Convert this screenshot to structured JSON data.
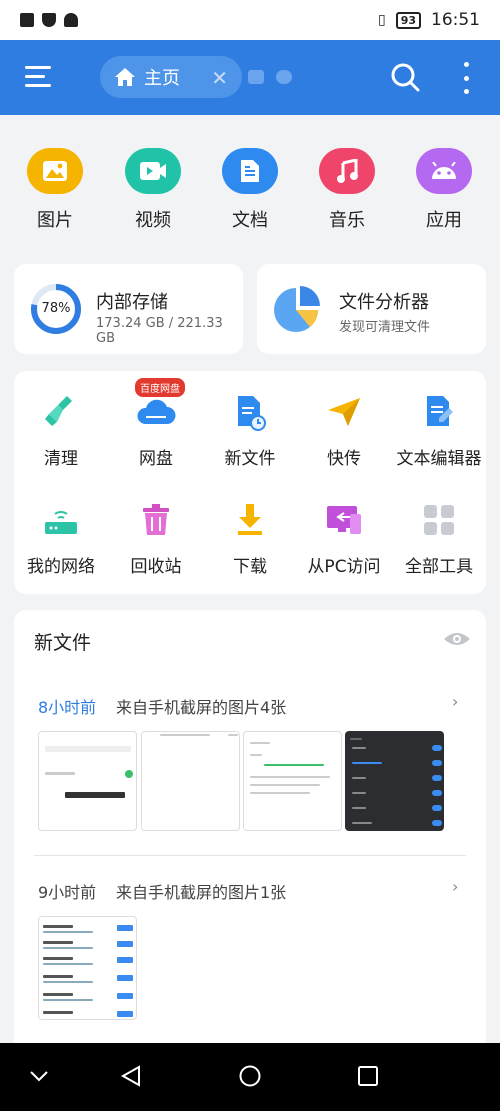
{
  "status_bar": {
    "time": "16:51",
    "battery": "93"
  },
  "header": {
    "home_tab_label": "主页",
    "bg_color": "#2f7de1"
  },
  "categories": [
    {
      "label": "图片",
      "icon": "image-icon",
      "color": "#f5b400"
    },
    {
      "label": "视频",
      "icon": "video-icon",
      "color": "#20c3a7"
    },
    {
      "label": "文档",
      "icon": "document-icon",
      "color": "#2f8aef"
    },
    {
      "label": "音乐",
      "icon": "music-icon",
      "color": "#f0456a"
    },
    {
      "label": "应用",
      "icon": "android-icon",
      "color": "#b569f0"
    }
  ],
  "storage": {
    "internal": {
      "title": "内部存储",
      "detail": "173.24 GB / 221.33 GB",
      "percent_label": "78%",
      "percent": 78
    },
    "analyzer": {
      "title": "文件分析器",
      "subtitle": "发现可清理文件"
    }
  },
  "tools": {
    "badge": "百度网盘",
    "items": [
      {
        "label": "清理",
        "icon": "broom-icon"
      },
      {
        "label": "网盘",
        "icon": "cloud-icon"
      },
      {
        "label": "新文件",
        "icon": "new-file-icon"
      },
      {
        "label": "快传",
        "icon": "send-icon"
      },
      {
        "label": "文本编辑器",
        "icon": "text-editor-icon"
      },
      {
        "label": "我的网络",
        "icon": "router-icon"
      },
      {
        "label": "回收站",
        "icon": "trash-icon"
      },
      {
        "label": "下载",
        "icon": "download-icon"
      },
      {
        "label": "从PC访问",
        "icon": "pc-access-icon"
      },
      {
        "label": "全部工具",
        "icon": "all-tools-icon"
      }
    ]
  },
  "new_files": {
    "title": "新文件",
    "groups": [
      {
        "time": "8小时前",
        "description": "来自手机截屏的图片4张"
      },
      {
        "time": "9小时前",
        "description": "来自手机截屏的图片1张"
      }
    ]
  }
}
